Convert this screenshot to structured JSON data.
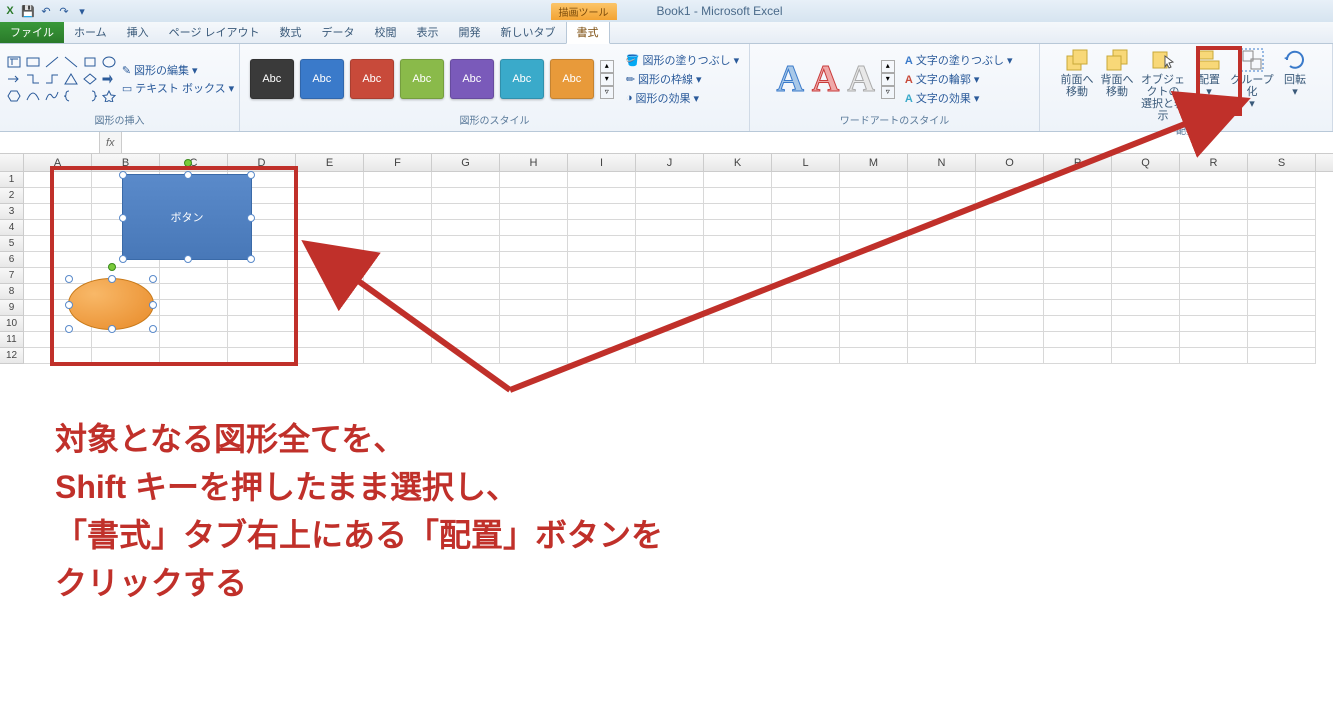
{
  "title": "Book1 - Microsoft Excel",
  "context_tab": "描画ツール",
  "qat_icons": [
    "excel",
    "save",
    "undo",
    "redo",
    "down"
  ],
  "tabs": [
    "ファイル",
    "ホーム",
    "挿入",
    "ページ レイアウト",
    "数式",
    "データ",
    "校閲",
    "表示",
    "開発",
    "新しいタブ",
    "書式"
  ],
  "active_tab": "書式",
  "ribbon": {
    "group_insert": {
      "label": "図形の挿入",
      "edit": "図形の編集",
      "textbox": "テキスト ボックス"
    },
    "group_style": {
      "label": "図形のスタイル",
      "swatches": [
        {
          "bg": "#3a3a3a",
          "txt": "Abc"
        },
        {
          "bg": "#3a7aca",
          "txt": "Abc"
        },
        {
          "bg": "#c84a3a",
          "txt": "Abc"
        },
        {
          "bg": "#8aba4a",
          "txt": "Abc"
        },
        {
          "bg": "#7a5aba",
          "txt": "Abc"
        },
        {
          "bg": "#3aaaca",
          "txt": "Abc"
        },
        {
          "bg": "#e89a3a",
          "txt": "Abc"
        }
      ],
      "fill": "図形の塗りつぶし",
      "outline": "図形の枠線",
      "effects": "図形の効果"
    },
    "group_wordart": {
      "label": "ワードアートのスタイル",
      "fill": "文字の塗りつぶし",
      "outline": "文字の輪郭",
      "effects": "文字の効果"
    },
    "group_arrange": {
      "label": "配置",
      "btns": [
        {
          "l1": "前面へ",
          "l2": "移動"
        },
        {
          "l1": "背面へ",
          "l2": "移動"
        },
        {
          "l1": "オブジェクトの",
          "l2": "選択と表示"
        },
        {
          "l1": "配置",
          "l2": ""
        },
        {
          "l1": "グループ化",
          "l2": ""
        },
        {
          "l1": "回転",
          "l2": ""
        }
      ]
    }
  },
  "columns": [
    "A",
    "B",
    "C",
    "D",
    "E",
    "F",
    "G",
    "H",
    "I",
    "J",
    "K",
    "L",
    "M",
    "N",
    "O",
    "P",
    "Q",
    "R",
    "S"
  ],
  "rows": [
    1,
    2,
    3,
    4,
    5,
    6,
    7,
    8,
    9,
    10,
    11,
    12
  ],
  "shape_button_text": "ボタン",
  "annotation_text": "対象となる図形全てを、\nShift キーを押したまま選択し、\n「書式」タブ右上にある「配置」ボタンを\nクリックする"
}
